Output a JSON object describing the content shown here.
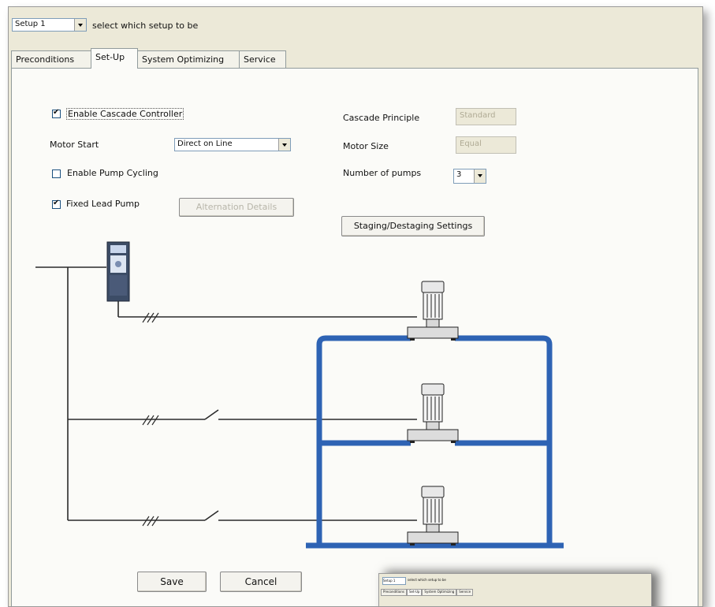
{
  "setup": {
    "selected": "Setup 1",
    "hint": "select which setup to be"
  },
  "tabs": [
    {
      "label": "Preconditions"
    },
    {
      "label": "Set-Up"
    },
    {
      "label": "System Optimizing"
    },
    {
      "label": "Service"
    }
  ],
  "form": {
    "enable_cascade": {
      "label": "Enable Cascade Controller",
      "checked": true
    },
    "motor_start": {
      "label": "Motor Start",
      "value": "Direct on Line"
    },
    "enable_pump_cycling": {
      "label": "Enable Pump Cycling",
      "checked": false
    },
    "fixed_lead_pump": {
      "label": "Fixed Lead Pump",
      "checked": true
    },
    "alternation_button": "Alternation Details",
    "cascade_principle": {
      "label": "Cascade Principle",
      "value": "Standard"
    },
    "motor_size": {
      "label": "Motor Size",
      "value": "Equal"
    },
    "number_of_pumps": {
      "label": "Number of pumps",
      "value": "3"
    },
    "staging_button": "Staging/Destaging Settings"
  },
  "actions": {
    "save": "Save",
    "cancel": "Cancel"
  },
  "thumbnail": {
    "setup": "Setup 1",
    "hint": "select which setup to be",
    "tabs": [
      "Preconditions",
      "Set-Up",
      "System Optimizing",
      "Service"
    ]
  },
  "colors": {
    "pipe": "#2e63b4",
    "window_bg": "#ece9d8",
    "panel_bg": "#fbfbf8"
  }
}
